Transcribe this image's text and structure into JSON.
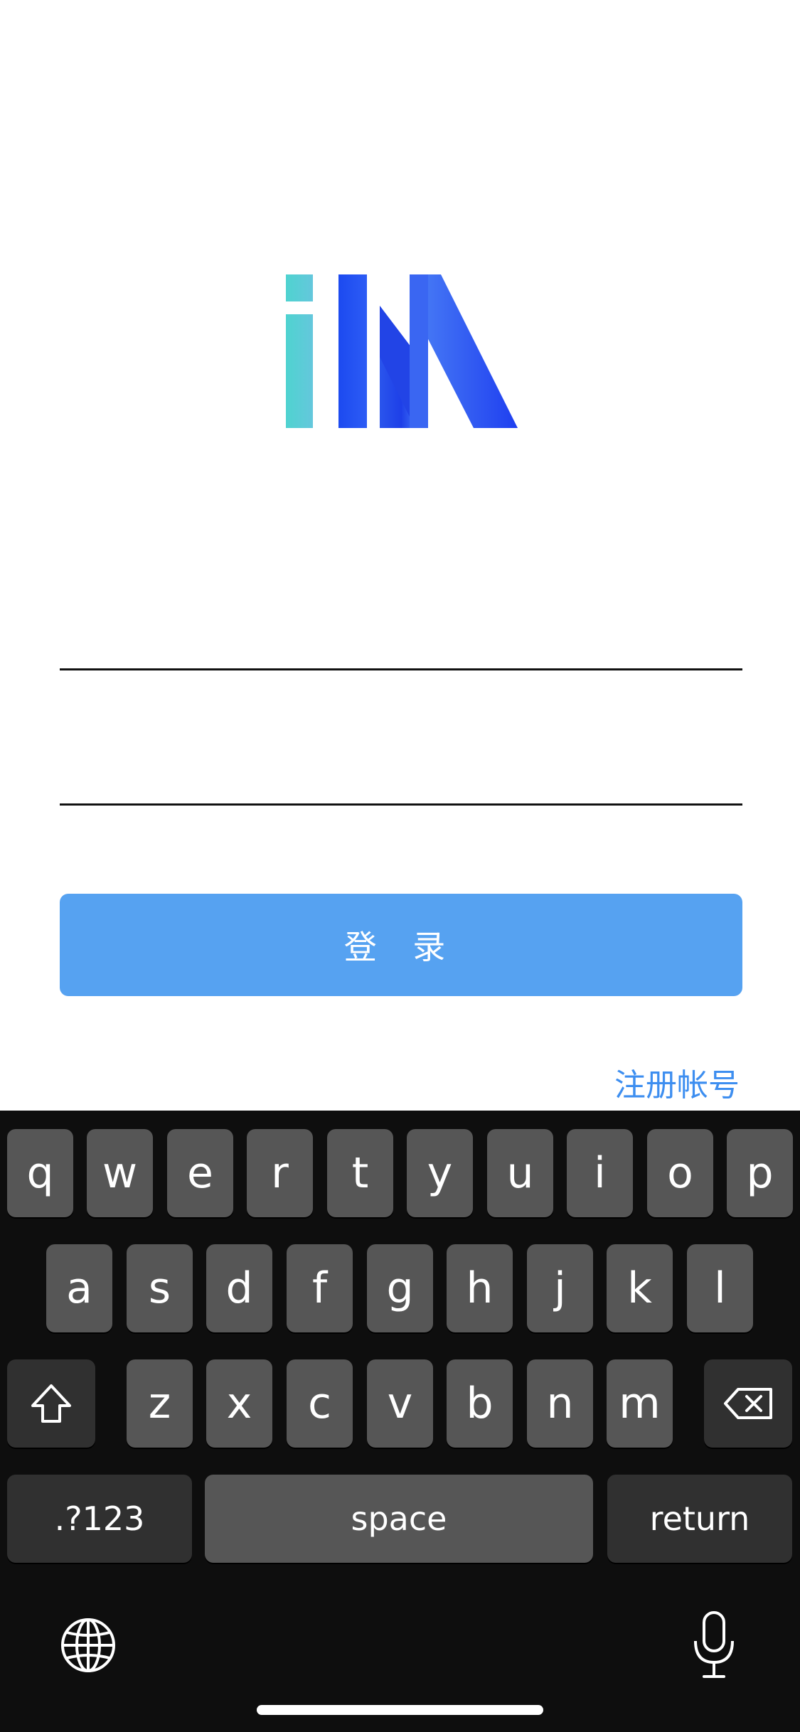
{
  "login": {
    "username_placeholder": "",
    "password_placeholder": "",
    "login_label": "登 录",
    "register_label": "注册帐号"
  },
  "keyboard": {
    "row1": [
      "q",
      "w",
      "e",
      "r",
      "t",
      "y",
      "u",
      "i",
      "o",
      "p"
    ],
    "row2": [
      "a",
      "s",
      "d",
      "f",
      "g",
      "h",
      "j",
      "k",
      "l"
    ],
    "row3": [
      "z",
      "x",
      "c",
      "v",
      "b",
      "n",
      "m"
    ],
    "numbers_label": ".?123",
    "space_label": "space",
    "return_label": "return"
  },
  "colors": {
    "accent": "#56a2f1",
    "link": "#3d8ef0",
    "keyboard_bg": "#0e0e0e",
    "key_bg": "#565656"
  }
}
